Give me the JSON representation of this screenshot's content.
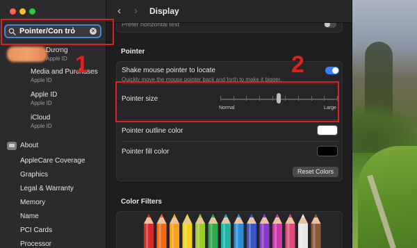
{
  "window": {
    "title": "Display"
  },
  "search": {
    "value": "Pointer/Con trỏ"
  },
  "account": {
    "name": "Dương",
    "sub": "Apple ID"
  },
  "sidebar": {
    "items": [
      {
        "label": "Media and Purchases",
        "sub": "Apple ID"
      },
      {
        "label": "Apple ID",
        "sub": "Apple ID"
      },
      {
        "label": "iCloud",
        "sub": "Apple ID"
      }
    ],
    "about": "About",
    "about_items": [
      "AppleCare Coverage",
      "Graphics",
      "Legal & Warranty",
      "Memory",
      "Name",
      "PCI Cards",
      "Processor"
    ]
  },
  "main": {
    "faded_top_label": "Prefer horizontal text",
    "pointer_section": "Pointer",
    "shake": {
      "label": "Shake mouse pointer to locate",
      "desc": "Quickly move the mouse pointer back and forth to make it bigger.",
      "enabled": true
    },
    "pointer_size": {
      "label": "Pointer size",
      "min_label": "Normal",
      "max_label": "Large",
      "level": 0.5,
      "ticks": 10
    },
    "outline_color": {
      "label": "Pointer outline color",
      "color": "#ffffff"
    },
    "fill_color": {
      "label": "Pointer fill color",
      "color": "#000000"
    },
    "reset_button": "Reset Colors",
    "color_filters_section": "Color Filters",
    "pencil_colors": [
      "#d92a2a",
      "#f06a1a",
      "#f7a21e",
      "#f4d21a",
      "#9ccc2a",
      "#2fa84a",
      "#22b3a4",
      "#2a8ed8",
      "#3a55c8",
      "#8a3ac8",
      "#c83aa8",
      "#e04a7a",
      "#e8e8e8",
      "#8a5a3a"
    ]
  },
  "annotations": {
    "label1": "1",
    "label2": "2",
    "color": "#e0201e"
  }
}
